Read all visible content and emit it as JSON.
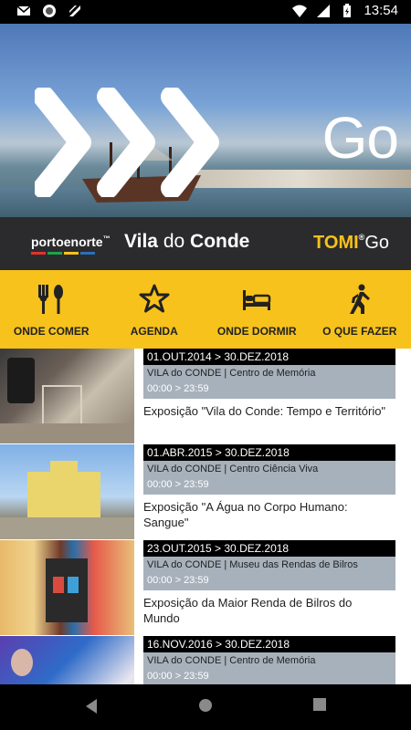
{
  "status": {
    "time": "13:54"
  },
  "hero": {
    "go_label": "Go"
  },
  "brand": {
    "porto_label": "portoenorte",
    "vila_main": "Vila",
    "vila_do": "do",
    "vila_conde": "Conde",
    "tomi_main": "TOMI",
    "tomi_go": "Go",
    "stripe_colors": [
      "#e4322b",
      "#1fa34a",
      "#f7c21b",
      "#2c6fb7"
    ]
  },
  "nav": {
    "items": [
      {
        "label": "ONDE COMER",
        "icon": "fork-spoon-icon"
      },
      {
        "label": "AGENDA",
        "icon": "star-icon"
      },
      {
        "label": "ONDE DORMIR",
        "icon": "bed-icon"
      },
      {
        "label": "O QUE FAZER",
        "icon": "walking-person-icon"
      }
    ]
  },
  "events": [
    {
      "dates": "01.OUT.2014 > 30.DEZ.2018",
      "location": "VILA do CONDE | Centro de Memória",
      "time": "00:00 > 23:59",
      "title": "Exposição \"Vila do Conde: Tempo e Território\""
    },
    {
      "dates": "01.ABR.2015 > 30.DEZ.2018",
      "location": "VILA do CONDE | Centro Ciência Viva",
      "time": "00:00 > 23:59",
      "title": "Exposição \"A Água no Corpo Humano: Sangue\""
    },
    {
      "dates": "23.OUT.2015 > 30.DEZ.2018",
      "location": "VILA do CONDE | Museu das Rendas de Bilros",
      "time": "00:00 > 23:59",
      "title": "Exposição da Maior Renda de Bilros do Mundo"
    },
    {
      "dates": "16.NOV.2016 > 30.DEZ.2018",
      "location": "VILA do CONDE | Centro de Memória",
      "time": "00:00 > 23:59",
      "title": ""
    }
  ],
  "colors": {
    "accent": "#f7c21b",
    "brandbar": "#2b2b2d",
    "info_bg": "#a7b1bb"
  }
}
